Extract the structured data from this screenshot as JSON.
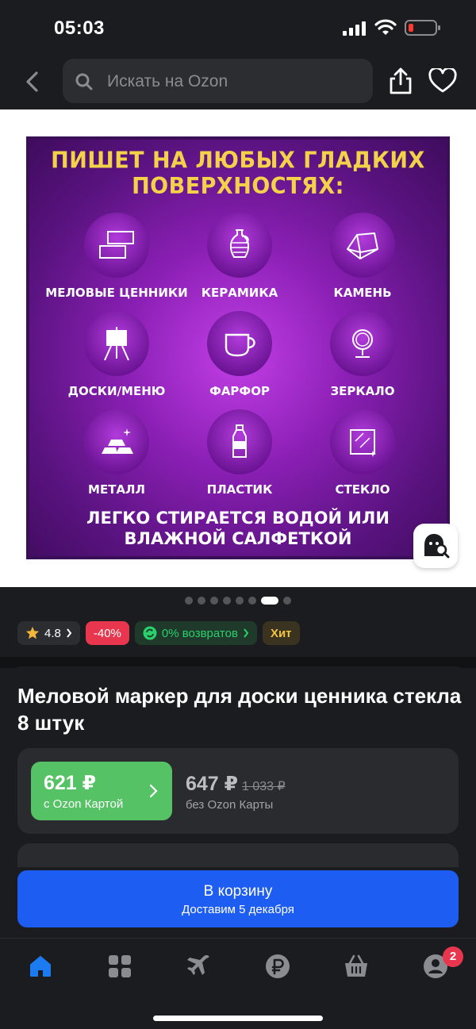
{
  "status_bar": {
    "time": "05:03"
  },
  "header": {
    "search_placeholder": "Искать на Ozon"
  },
  "banner": {
    "title": "ПИШЕТ НА ЛЮБЫХ ГЛАДКИХ ПОВЕРХНОСТЯХ:",
    "features": [
      {
        "label": "МЕЛОВЫЕ ЦЕННИКИ",
        "icon": "price-tags-icon"
      },
      {
        "label": "КЕРАМИКА",
        "icon": "vase-icon"
      },
      {
        "label": "КАМЕНЬ",
        "icon": "stone-icon"
      },
      {
        "label": "ДОСКИ/МЕНЮ",
        "icon": "easel-icon"
      },
      {
        "label": "ФАРФОР",
        "icon": "cup-icon"
      },
      {
        "label": "ЗЕРКАЛО",
        "icon": "mirror-icon"
      },
      {
        "label": "МЕТАЛЛ",
        "icon": "metal-bars-icon"
      },
      {
        "label": "ПЛАСТИК",
        "icon": "bottle-icon"
      },
      {
        "label": "СТЕКЛО",
        "icon": "glass-icon"
      }
    ],
    "footer_line1": "ЛЕГКО СТИРАЕТСЯ ВОДОЙ ИЛИ",
    "footer_line2": "ВЛАЖНОЙ САЛФЕТКОЙ"
  },
  "gallery": {
    "image_count": 8,
    "active_index": 6
  },
  "chips": {
    "rating": "4.8",
    "discount": "-40%",
    "returns": "0% возвратов",
    "hit": "Хит"
  },
  "product": {
    "title": "Меловой маркер для доски ценника стекла 8 штук",
    "card_price": "621 ₽",
    "card_price_label": "с Ozon Картой",
    "price": "647 ₽",
    "old_price": "1 033 ₽",
    "price_label": "без Ozon Карты"
  },
  "cart_button": {
    "label": "В корзину",
    "sublabel": "Доставим 5 декабря"
  },
  "tabbar": {
    "items": [
      {
        "name": "home",
        "icon": "home-icon"
      },
      {
        "name": "catalog",
        "icon": "grid-icon"
      },
      {
        "name": "travel",
        "icon": "airplane-icon"
      },
      {
        "name": "finance",
        "icon": "ruble-icon"
      },
      {
        "name": "cart",
        "icon": "basket-icon"
      },
      {
        "name": "profile",
        "icon": "profile-icon"
      }
    ],
    "profile_badge": "2"
  },
  "colors": {
    "accent_blue": "#1d5df2",
    "ozon_card_green": "#55c265",
    "discount_red": "#e7364d",
    "background": "#1b1c1f"
  }
}
